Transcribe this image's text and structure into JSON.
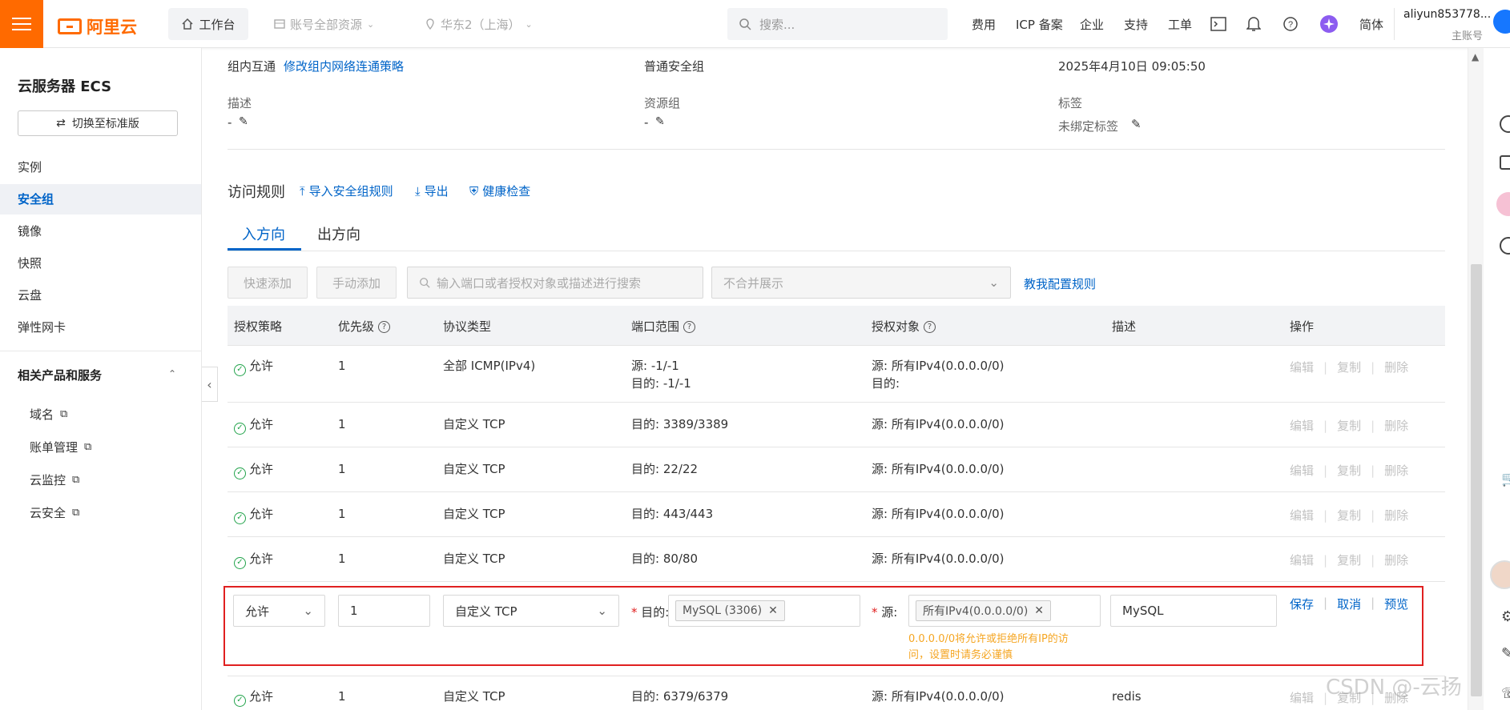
{
  "topbar": {
    "brand": "阿里云",
    "workbench": "工作台",
    "resources": "账号全部资源",
    "region": "华东2（上海）",
    "search_placeholder": "搜索...",
    "links": [
      "费用",
      "ICP 备案",
      "企业",
      "支持",
      "工单"
    ],
    "language": "简体",
    "account_name": "aliyun853778...",
    "account_type": "主账号"
  },
  "sidebar": {
    "title": "云服务器 ECS",
    "switch_label": "切换至标准版",
    "items": [
      "实例",
      "安全组",
      "镜像",
      "快照",
      "云盘",
      "弹性网卡"
    ],
    "active_index": 1,
    "related_title": "相关产品和服务",
    "related_items": [
      "域名",
      "账单管理",
      "云监控",
      "云安全"
    ]
  },
  "details": {
    "intranet_label": "组内互通",
    "intranet_link": "修改组内网络连通策略",
    "group_type": "普通安全组",
    "created_time": "2025年4月10日 09:05:50",
    "desc_label": "描述",
    "desc_value": "-",
    "rg_label": "资源组",
    "rg_value": "-",
    "tags_label": "标签",
    "tags_value": "未绑定标签"
  },
  "rules": {
    "title": "访问规则",
    "import_link": "导入安全组规则",
    "export_link": "导出",
    "health_link": "健康检查",
    "tabs": [
      "入方向",
      "出方向"
    ],
    "quick_add": "快速添加",
    "manual_add": "手动添加",
    "search_placeholder": "输入端口或者授权对象或描述进行搜索",
    "merge_select": "不合并展示",
    "tutorial_link": "教我配置规则",
    "columns": [
      "授权策略",
      "优先级",
      "协议类型",
      "端口范围",
      "授权对象",
      "描述",
      "操作"
    ],
    "ops": [
      "编辑",
      "复制",
      "删除"
    ],
    "rows": [
      {
        "policy": "允许",
        "priority": "1",
        "protocol": "全部 ICMP(IPv4)",
        "port": "源: -1/-1",
        "port2": "目的: -1/-1",
        "target": "源: 所有IPv4(0.0.0.0/0)",
        "target2": "目的:",
        "desc": ""
      },
      {
        "policy": "允许",
        "priority": "1",
        "protocol": "自定义 TCP",
        "port": "目的: 3389/3389",
        "target": "源: 所有IPv4(0.0.0.0/0)",
        "desc": ""
      },
      {
        "policy": "允许",
        "priority": "1",
        "protocol": "自定义 TCP",
        "port": "目的: 22/22",
        "target": "源: 所有IPv4(0.0.0.0/0)",
        "desc": ""
      },
      {
        "policy": "允许",
        "priority": "1",
        "protocol": "自定义 TCP",
        "port": "目的: 443/443",
        "target": "源: 所有IPv4(0.0.0.0/0)",
        "desc": ""
      },
      {
        "policy": "允许",
        "priority": "1",
        "protocol": "自定义 TCP",
        "port": "目的: 80/80",
        "target": "源: 所有IPv4(0.0.0.0/0)",
        "desc": ""
      }
    ],
    "edit_row": {
      "policy": "允许",
      "priority": "1",
      "protocol": "自定义 TCP",
      "port_label": "目的:",
      "port_tag": "MySQL (3306)",
      "target_label": "源:",
      "target_tag": "所有IPv4(0.0.0.0/0)",
      "warning": "0.0.0.0/0将允许或拒绝所有IP的访问，设置时请务必谨慎",
      "desc": "MySQL",
      "save": "保存",
      "cancel": "取消",
      "preview": "预览"
    },
    "last_row": {
      "policy": "允许",
      "priority": "1",
      "protocol": "自定义 TCP",
      "port": "目的: 6379/6379",
      "target": "源: 所有IPv4(0.0.0.0/0)",
      "desc": "redis"
    }
  },
  "watermark": "CSDN @-云扬",
  "colors": {
    "brand": "#ff6a00",
    "link": "#0064c8",
    "allow": "#22a34b",
    "highlight_border": "#e02020",
    "warning": "#f5a623"
  }
}
